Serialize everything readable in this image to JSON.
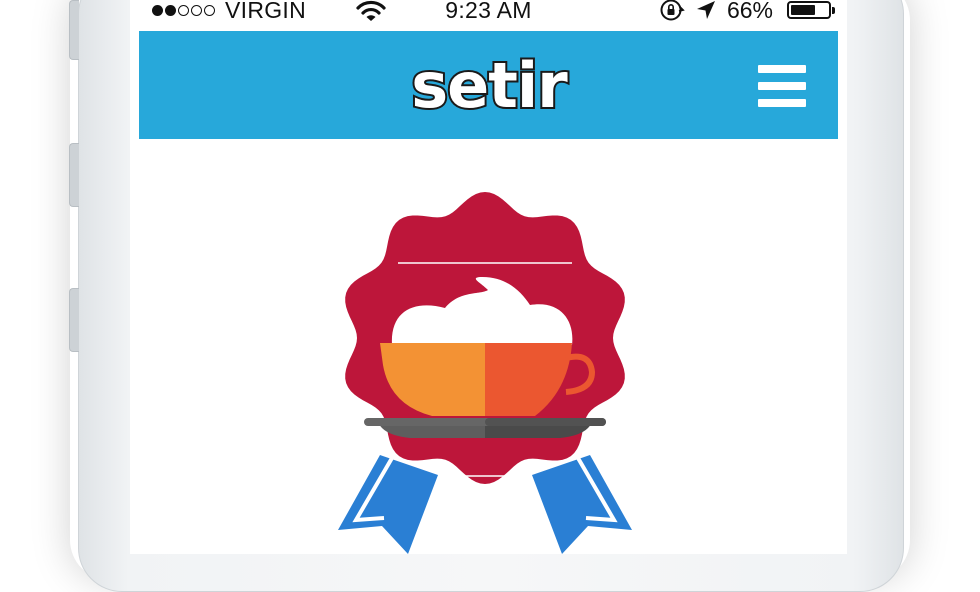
{
  "status_bar": {
    "carrier": "VIRGIN",
    "time": "9:23 AM",
    "battery_percent": "66%",
    "battery_level": 0.66,
    "signal_bars_filled": 2,
    "signal_bars_total": 5
  },
  "nav": {
    "logo_text": "setir",
    "background_color": "#27a8da"
  },
  "badge": {
    "rosette_color": "#bd163a",
    "ribbon_color": "#2a7fd4",
    "cup_colors": [
      "#f39234",
      "#eb5730"
    ],
    "saucer_color": "#4d4d4d"
  }
}
